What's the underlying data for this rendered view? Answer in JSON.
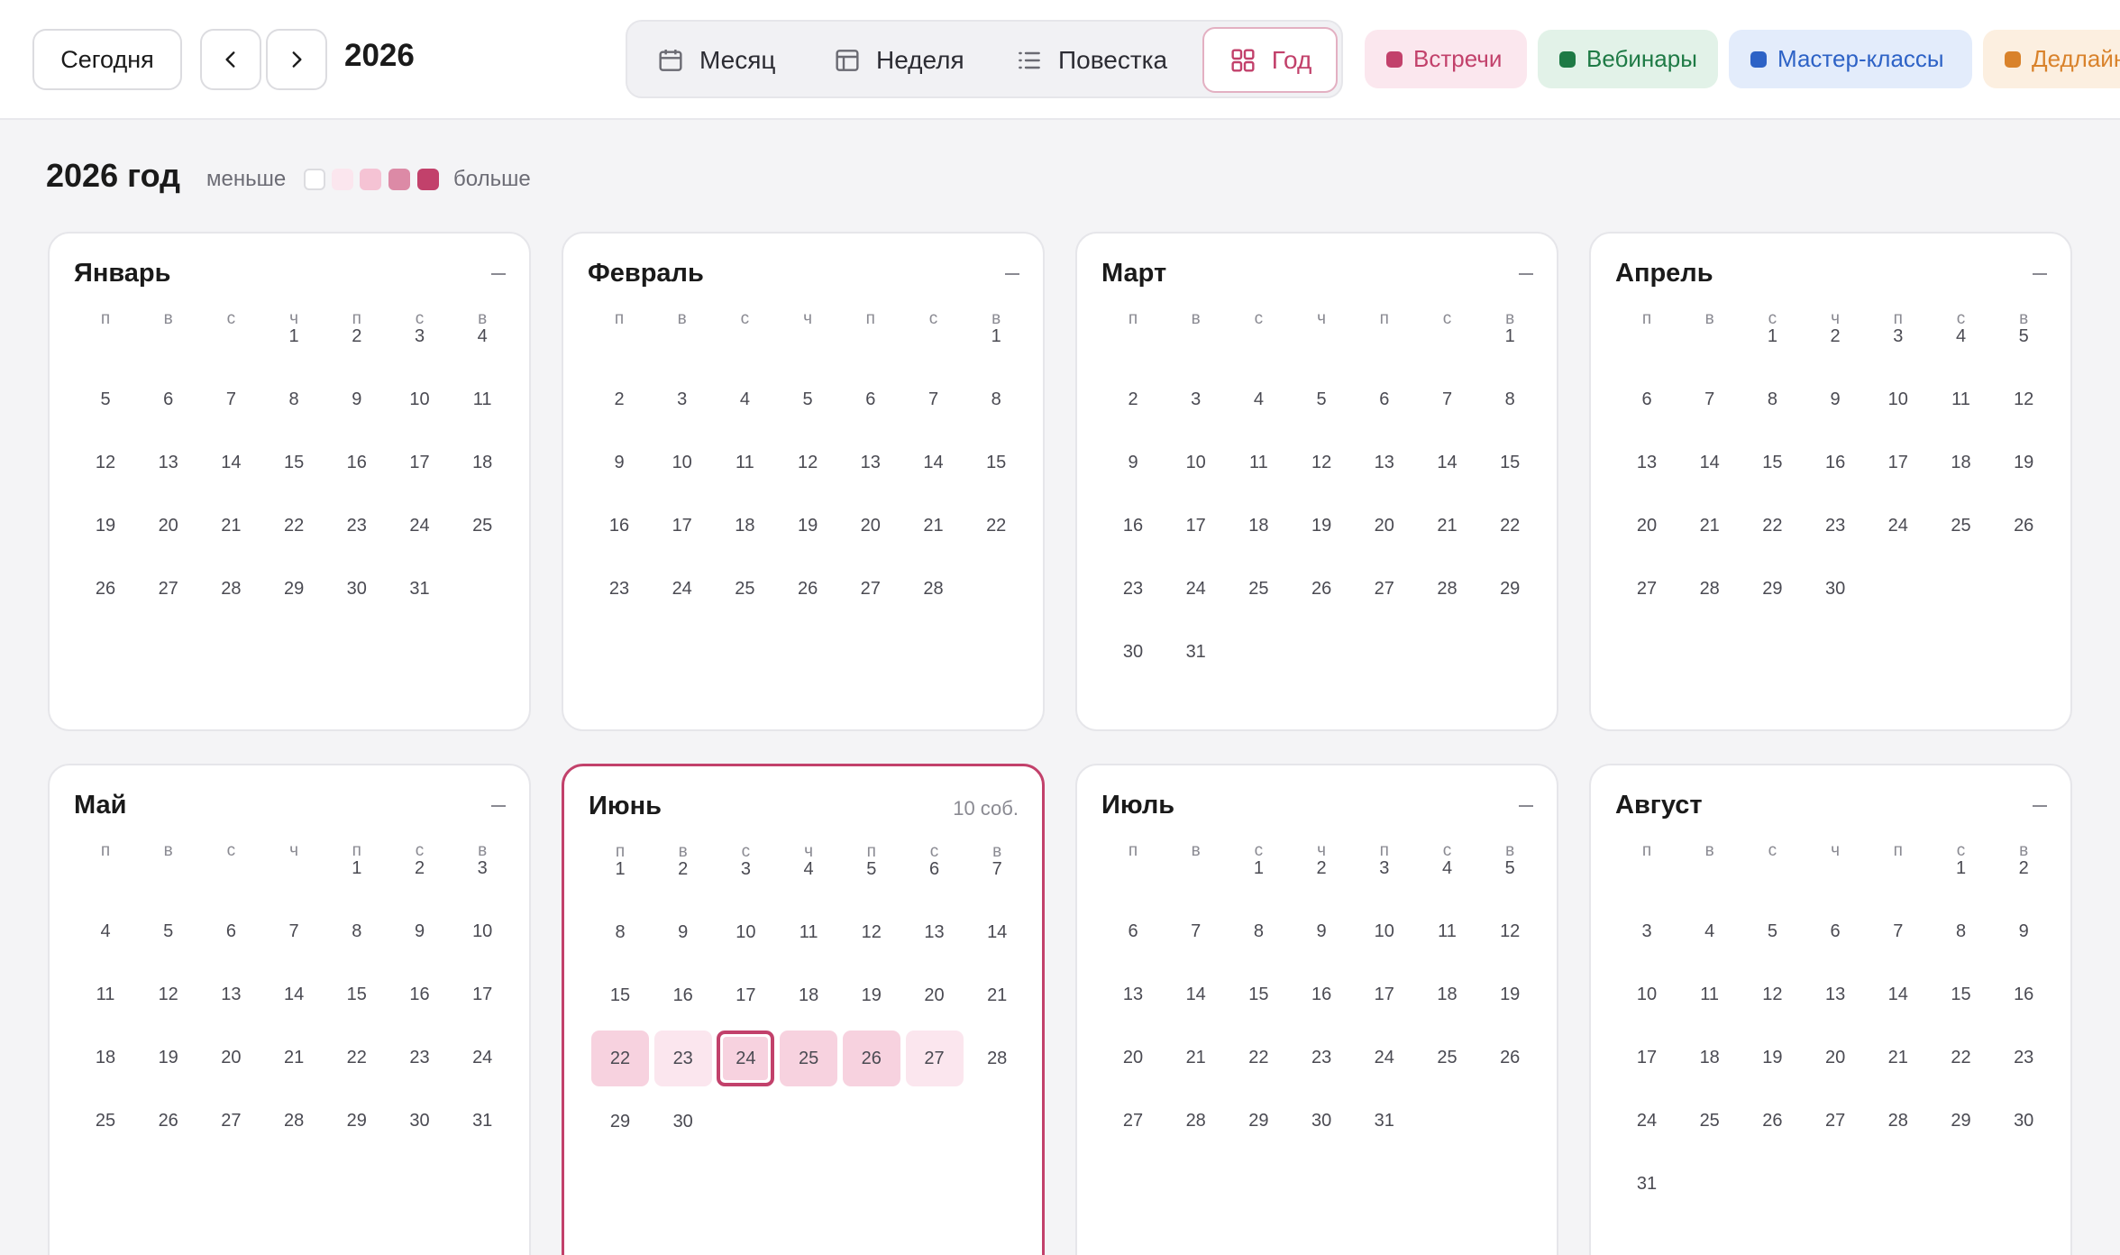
{
  "toolbar": {
    "today_label": "Сегодня",
    "year": "2026",
    "views": [
      "Месяц",
      "Неделя",
      "Повестка",
      "Год"
    ],
    "active_view": "Год",
    "categories": [
      {
        "label": "Встречи",
        "color": "#c2416b"
      },
      {
        "label": "Вебинары",
        "color": "#1e7a45"
      },
      {
        "label": "Мастер-классы",
        "color": "#2d62c6"
      },
      {
        "label": "Дедлайн",
        "color": "#d9822b"
      }
    ]
  },
  "main": {
    "heading": "2026 год",
    "legend_less": "меньше",
    "legend_more": "больше",
    "weekdays": [
      "п",
      "в",
      "с",
      "ч",
      "п",
      "с",
      "в"
    ],
    "months": [
      {
        "name": "Январь",
        "offset": 3,
        "days": 31,
        "count": ""
      },
      {
        "name": "Февраль",
        "offset": 6,
        "days": 28,
        "count": ""
      },
      {
        "name": "Март",
        "offset": 6,
        "days": 31,
        "count": ""
      },
      {
        "name": "Апрель",
        "offset": 2,
        "days": 30,
        "count": ""
      },
      {
        "name": "Май",
        "offset": 4,
        "days": 31,
        "count": ""
      },
      {
        "name": "Июнь",
        "offset": 0,
        "days": 30,
        "count": "10 соб.",
        "active": true,
        "heat": {
          "22": 2,
          "23": 1,
          "24": 2,
          "25": 2,
          "26": 2,
          "27": 1
        },
        "today": 24
      },
      {
        "name": "Июль",
        "offset": 2,
        "days": 31,
        "count": ""
      },
      {
        "name": "Август",
        "offset": 5,
        "days": 31,
        "count": ""
      }
    ]
  }
}
